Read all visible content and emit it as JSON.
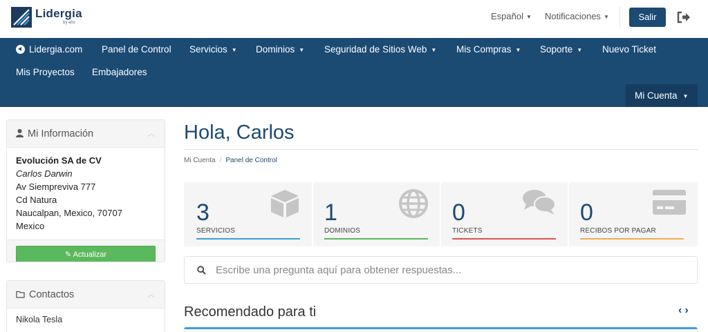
{
  "brand": {
    "name": "Lidergia",
    "sub": "by ahs"
  },
  "topbar": {
    "language": "Español",
    "notifications": "Notificaciones",
    "logout_label": "Salir"
  },
  "nav": {
    "home": "Lidergia.com",
    "items": [
      {
        "label": "Panel de Control"
      },
      {
        "label": "Servicios"
      },
      {
        "label": "Dominios"
      },
      {
        "label": "Seguridad de Sitios Web"
      },
      {
        "label": "Mis Compras"
      },
      {
        "label": "Soporte"
      },
      {
        "label": "Nuevo Ticket"
      },
      {
        "label": "Mis Proyectos"
      },
      {
        "label": "Embajadores"
      }
    ],
    "account": "Mi Cuenta"
  },
  "sidebar": {
    "info_title": "Mi Información",
    "company": "Evolución SA de CV",
    "person": "Carlos Darwin",
    "address1": "Av Siempreviva 777",
    "address2": "Cd Natura",
    "address3": "Naucalpan, Mexico, 70707",
    "country": "Mexico",
    "update_label": "Actualizar",
    "contacts_title": "Contactos",
    "contacts": [
      {
        "name": "Nikola Tesla"
      }
    ]
  },
  "main": {
    "greeting": "Hola, Carlos",
    "breadcrumb": {
      "root": "Mi Cuenta",
      "current": "Panel de Control"
    },
    "stats": [
      {
        "value": "3",
        "label": "SERVICIOS",
        "color": "#3aa0d8",
        "icon": "box-icon"
      },
      {
        "value": "1",
        "label": "DOMINIOS",
        "color": "#5cb85c",
        "icon": "globe-icon"
      },
      {
        "value": "0",
        "label": "TICKETS",
        "color": "#d9534f",
        "icon": "comments-icon"
      },
      {
        "value": "0",
        "label": "RECIBOS POR PAGAR",
        "color": "#f0ad4e",
        "icon": "credit-card-icon"
      }
    ],
    "search_placeholder": "Escribe una pregunta aquí para obtener respuestas...",
    "recommended_title": "Recomendado para ti"
  }
}
